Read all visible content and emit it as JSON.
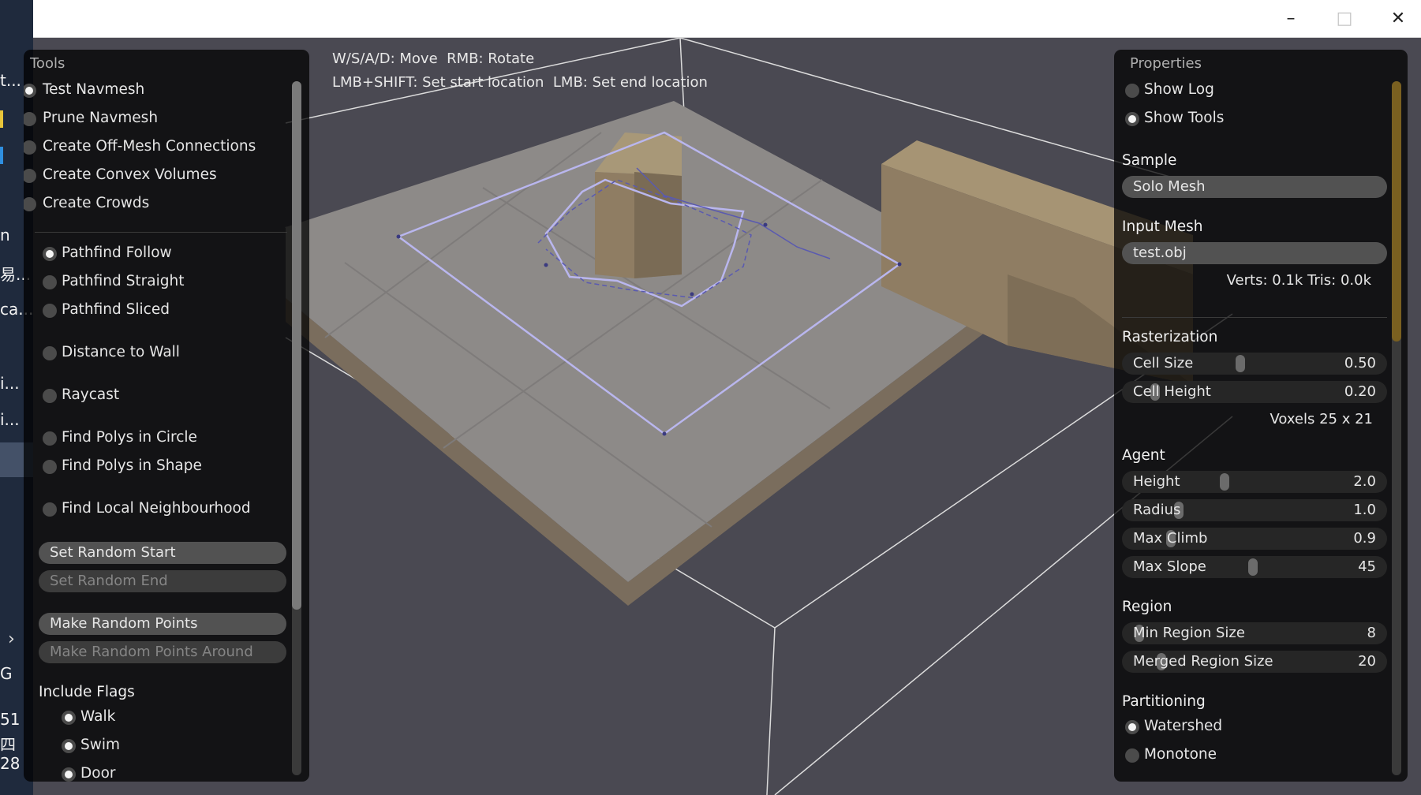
{
  "desktop_fragments": [
    "t...",
    "n",
    "易...",
    "ca...",
    "i...",
    "i...",
    "G",
    "51",
    "四",
    "28"
  ],
  "window": {
    "min_icon": "minimize-icon",
    "max_icon": "maximize-icon",
    "close_icon": "close-icon"
  },
  "help": {
    "line1": "W/S/A/D: Move  RMB: Rotate",
    "line2": "LMB+SHIFT: Set start location  LMB: Set end location"
  },
  "tools": {
    "title": "Tools",
    "modes": [
      {
        "label": "Test Navmesh",
        "checked": true
      },
      {
        "label": "Prune Navmesh",
        "checked": false
      },
      {
        "label": "Create Off-Mesh Connections",
        "checked": false
      },
      {
        "label": "Create Convex Volumes",
        "checked": false
      },
      {
        "label": "Create Crowds",
        "checked": false
      }
    ],
    "options": [
      {
        "label": "Pathfind Follow",
        "checked": true
      },
      {
        "label": "Pathfind Straight",
        "checked": false
      },
      {
        "label": "Pathfind Sliced",
        "checked": false
      },
      {
        "label": "Distance to Wall",
        "checked": false
      },
      {
        "label": "Raycast",
        "checked": false
      },
      {
        "label": "Find Polys in Circle",
        "checked": false
      },
      {
        "label": "Find Polys in Shape",
        "checked": false
      },
      {
        "label": "Find Local Neighbourhood",
        "checked": false
      }
    ],
    "buttons": [
      {
        "label": "Set Random Start",
        "enabled": true
      },
      {
        "label": "Set Random End",
        "enabled": false
      },
      {
        "label": "Make Random Points",
        "enabled": true
      },
      {
        "label": "Make Random Points Around",
        "enabled": false
      }
    ],
    "include_flags": {
      "title": "Include Flags",
      "items": [
        {
          "label": "Walk",
          "checked": true
        },
        {
          "label": "Swim",
          "checked": true
        },
        {
          "label": "Door",
          "checked": true
        }
      ]
    }
  },
  "properties": {
    "title": "Properties",
    "show_log": {
      "label": "Show Log",
      "checked": false
    },
    "show_tools": {
      "label": "Show Tools",
      "checked": true
    },
    "sample": {
      "title": "Sample",
      "value": "Solo Mesh"
    },
    "input_mesh": {
      "title": "Input Mesh",
      "value": "test.obj",
      "stats": "Verts: 0.1k  Tris: 0.0k"
    },
    "rasterization": {
      "title": "Rasterization",
      "cell_size": {
        "label": "Cell Size",
        "value": "0.50",
        "fraction": 0.46
      },
      "cell_height": {
        "label": "Cell Height",
        "value": "0.20",
        "fraction": 0.12
      },
      "voxels": "Voxels  25 x 21"
    },
    "agent": {
      "title": "Agent",
      "height": {
        "label": "Height",
        "value": "2.0",
        "fraction": 0.38
      },
      "radius": {
        "label": "Radius",
        "value": "1.0",
        "fraction": 0.2
      },
      "max_climb": {
        "label": "Max Climb",
        "value": "0.9",
        "fraction": 0.17
      },
      "max_slope": {
        "label": "Max Slope",
        "value": "45",
        "fraction": 0.5
      }
    },
    "region": {
      "title": "Region",
      "min_size": {
        "label": "Min Region Size",
        "value": "8",
        "fraction": 0.05
      },
      "merged_size": {
        "label": "Merged Region Size",
        "value": "20",
        "fraction": 0.14
      }
    },
    "partitioning": {
      "title": "Partitioning",
      "watershed": {
        "label": "Watershed",
        "checked": true
      },
      "monotone": {
        "label": "Monotone",
        "checked": false
      }
    }
  },
  "colors": {
    "viewport_bg": "#4a4952",
    "floor": "#8d8a88",
    "box": "#8f7d63",
    "path_line": "#b9b6ee",
    "panel_bg": "rgba(0,0,0,0.74)"
  }
}
